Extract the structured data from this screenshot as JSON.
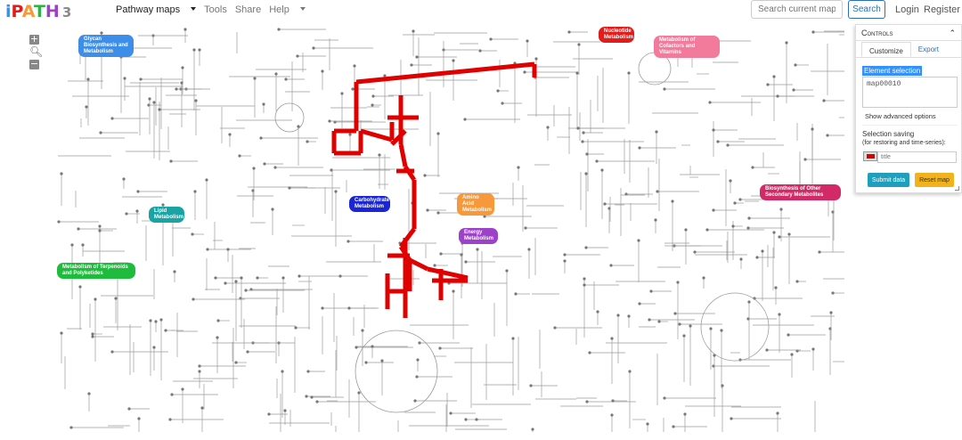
{
  "brand": {
    "name": "iPATH",
    "version": "3"
  },
  "nav": {
    "pathway_maps": "Pathway maps",
    "tools": "Tools",
    "share": "Share",
    "help": "Help"
  },
  "search": {
    "placeholder": "Search current map",
    "button": "Search"
  },
  "account": {
    "login": "Login",
    "register": "Register"
  },
  "zoom": {
    "in": "+",
    "out": "−"
  },
  "map_labels": [
    {
      "text": "Glycan Biosynthesis and Metabolism",
      "color": "#3c8ee8"
    },
    {
      "text": "Nucleotide Metabolism",
      "color": "#e21b1b"
    },
    {
      "text": "Metabolism of Cofactors and Vitamins",
      "color": "#f27a9a"
    },
    {
      "text": "Carbohydrate Metabolism",
      "color": "#1a26d6"
    },
    {
      "text": "Amino Acid Metabolism",
      "color": "#f7993a"
    },
    {
      "text": "Energy Metabolism",
      "color": "#9b42c8"
    },
    {
      "text": "Lipid Metabolism",
      "color": "#1aa3a3"
    },
    {
      "text": "Metabolism of Terpenoids and Polyketides",
      "color": "#1fbb3d"
    },
    {
      "text": "Biosynthesis of Other Secondary Metabolites",
      "color": "#d22a66"
    }
  ],
  "controls": {
    "title": "Controls",
    "tabs": [
      "Customize",
      "Export"
    ],
    "element_selection_label": "Element selection",
    "element_selection_value": "map00010",
    "advanced": "Show advanced options",
    "selection_saving": "Selection saving",
    "selection_saving_sub": "(for restoring and time-series):",
    "title_placeholder": "title",
    "highlight_color": "#dd0000",
    "submit": "Submit data",
    "reset": "Reset map"
  }
}
